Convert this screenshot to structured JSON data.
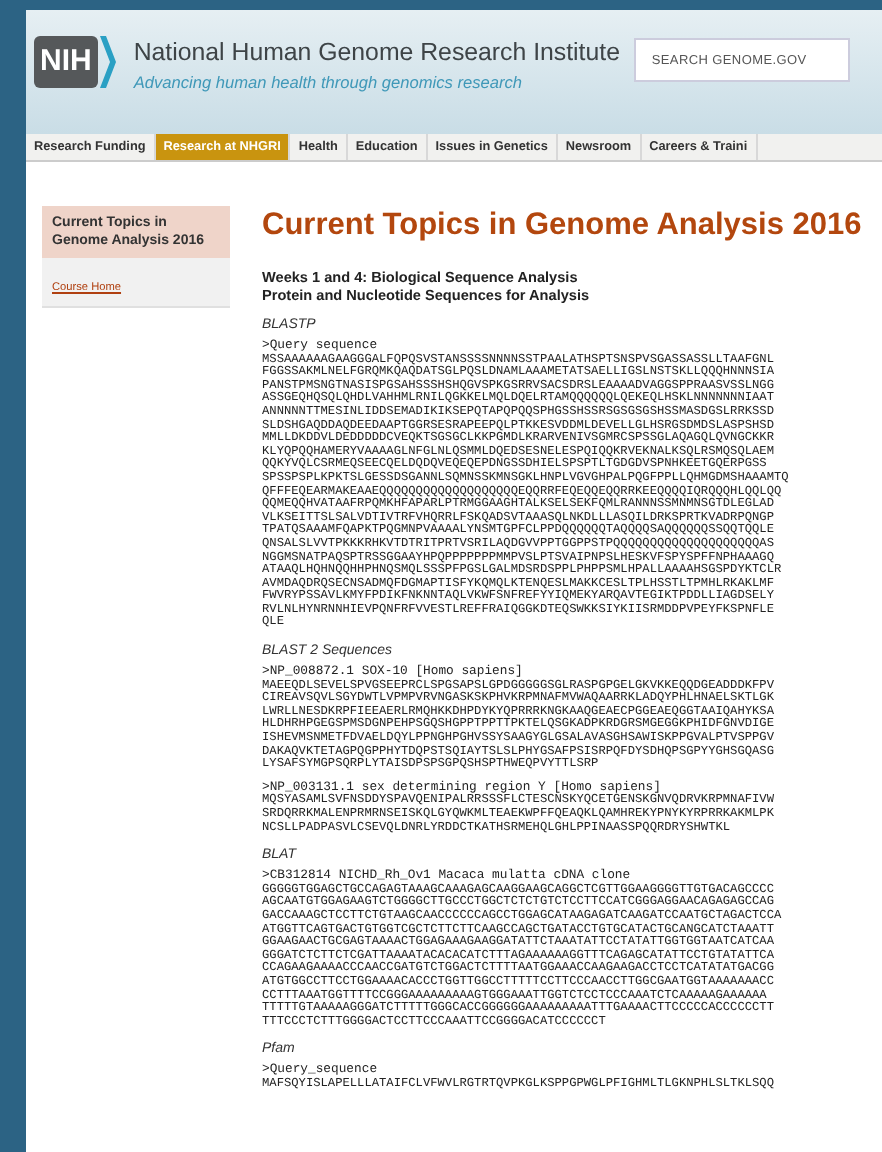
{
  "header": {
    "logo_text": "NIH",
    "org_name": "National Human Genome Research Institute",
    "tagline": "Advancing human health through genomics research",
    "search": {
      "placeholder": "SEARCH GENOME.GOV"
    }
  },
  "nav": [
    {
      "label": "Research Funding",
      "selected": false
    },
    {
      "label": "Research at NHGRI",
      "selected": true
    },
    {
      "label": "Health",
      "selected": false
    },
    {
      "label": "Education",
      "selected": false
    },
    {
      "label": "Issues in Genetics",
      "selected": false
    },
    {
      "label": "Newsroom",
      "selected": false
    },
    {
      "label": "Careers & Traini",
      "selected": false
    }
  ],
  "sidebar": {
    "title": "Current Topics in Genome Analysis 2016",
    "links": [
      "Course Home"
    ]
  },
  "content": {
    "title": "Current Topics in Genome Analysis 2016",
    "subtitle_lines": [
      "Weeks 1 and 4: Biological Sequence Analysis",
      "Protein and Nucleotide Sequences for Analysis"
    ],
    "sections": [
      {
        "heading": "BLASTP",
        "sequences": [
          {
            "header": ">Query sequence",
            "lines": [
              "MSSAAAAAAGAAGGGALFQPQSVSTANSSSSNNNNSSTPAALATHSPTSNSPVSGASSASSLLTAAFGNL",
              "FGGSSAKMLNELFGRQMKQAQDATSGLPQSLDNAMLAAAMETATSAELLIGSLNSTSKLLQQQHNNNSIA",
              "PANSTPMSNGTNASISPGSAHSSSHSHQGVSPKGSRRVSACSDRSLEAAAADVAGGSPPRAASVSSLNGG",
              "ASSGEQHQSQLQHDLVAHHMLRNILQGKKELMQLDQELRTAMQQQQQQLQEKEQLHSKLNNNNNNNIAAT",
              "ANNNNNTTMESINLIDDSEMADIKIKSEPQTAPQPQQSPHGSSHSSRSGSGSGSHSSMASDGSLRRKSSD",
              "SLDSHGAQDDAQDEEDAAPTGGRSESRAPEEPQLPTKKESVDDMLDEVELLGLHSRGSDMDSLASPSHSD",
              "MMLLDKDDVLDEDDDDDCVEQKTSGSGCLKKPGMDLKRARVENIVSGMRCSPSSGLAQAGQLQVNGCKKR",
              "KLYQPQQHAMERYVAAAAGLNFGLNLQSMMLDQEDSESNELESPQIQQKRVEKNALKSQLRSMQSQLAEM",
              "QQKYVQLCSRMEQSEECQELDQDQVEQEQEPDNGSSDHIELSPSPTLTGDGDVSPNHKEETGQERPGSS",
              "SPSSPSPLKPKTSLGESSDSGANNLSQMNSSKMNSGKLHNPLVGVGHPALPQGFPPLLQHMGDMSHAAAMTQ",
              "QFFFEQEARMAKEAAEQQQQQQQQQQQQQQQQQQQEQQRRFEQEQQEQQRRKEEQQQQIQRQQQHLQQLQQ",
              "QQMEQQHVATAAFRPQMKHFAPARLPTRMGGAAGHTALKSELSEKFQMLRANNNSSMNMNSGTDLEGLAD",
              "VLKSEITTSLSALVDTIVTRFVHQRRLFSKQADSVTAAASQLNKDLLLASQILDRKSPRTKVADRPQNGP",
              "TPATQSAAAMFQAPKTPQGMNPVAAAALYNSMTGPFCLPPDQQQQQQTAQQQQSAQQQQQQSSQQTQQLE",
              "QNSALSLVVTPKKKRHKVTDTRITPRTVSRILAQDGVVPPTGGPPSTPQQQQQQQQQQQQQQQQQQQQAS",
              "NGGMSNATPAQSPTRSSGGAAYHPQPPPPPPPMMPVSLPTSVAIPNPSLHESKVFSPYSPFFNPHAAAGQ",
              "ATAAQLHQHNQQHHPHNQSMQLSSSPFPGSLGALMDSRDSPPLPHPPSMLHPALLAAAAHSGSPDYKTCLR",
              "AVMDAQDRQSECNSADMQFDGMAPTISFYKQMQLKTENQESLMAKKCESLTPLHSSTLTPMHLRKAKLMF",
              "FWVRYPSSAVLKMYFPDIKFNKNNTAQLVKWFSNFREFYYIQMEKYARQAVTEGIKTPDDLLIAGDSELY",
              "RVLNLHYNRNNHIEVPQNFRFVVESTLREFFRAIQGGKDTEQSWKKSIYKIISRMDDPVPEYFKSPNFLE",
              "QLE"
            ]
          }
        ]
      },
      {
        "heading": "BLAST 2 Sequences",
        "sequences": [
          {
            "header": ">NP_008872.1 SOX-10 [Homo sapiens]",
            "lines": [
              "MAEEQDLSEVELSPVGSEEPRCLSPGSAPSLGPDGGGGGSGLRASPGPGELGKVKKEQQDGEADDDKFPV",
              "CIREAVSQVLSGYDWTLVPMPVRVNGASKSKPHVKRPMNAFMVWAQAARRKLADQYPHLHNAELSKTLGK",
              "LWRLLNESDKRPFIEEAERLRMQHKKDHPDYKYQPRRRKNGKAAQGEAECPGGEAEQGGTAAIQAHYKSA",
              "HLDHRHPGEGSPMSDGNPEHPSGQSHGPPTPPTTPKTELQSGKADPKRDGRSMGEGGKPHIDFGNVDIGE",
              "ISHEVMSNMETFDVAELDQYLPPNGHPGHVSSYSAAGYGLGSALAVASGHSAWISKPPGVALPTVSPPGV",
              "DAKAQVKTETAGPQGPPHYTDQPSTSQIAYTSLSLPHYGSAFPSISRPQFDYSDHQPSGPYYGHSGQASG",
              "LYSAFSYMGPSQRPLYTAISDPSPSGPQSHSPTHWEQPVYTTLSRP"
            ]
          },
          {
            "header": ">NP_003131.1 sex determining region Y [Homo sapiens]",
            "lines": [
              "MQSYASAMLSVFNSDDYSPAVQENIPALRRSSSFLCTESCNSKYQCETGENSKGNVQDRVKRPMNAFIVW",
              "SRDQRRKMALENPRMRNSEISKQLGYQWKMLTEAEKWPFFQEAQKLQAMHREKYPNYKYRPRRKAKMLPK",
              "NCSLLPADPASVLCSEVQLDNRLYRDDCTKATHSRMEHQLGHLPPINAASSPQQRDRYSHWTKL"
            ]
          }
        ]
      },
      {
        "heading": "BLAT",
        "sequences": [
          {
            "header": ">CB312814 NICHD_Rh_Ov1 Macaca mulatta cDNA clone",
            "lines": [
              "GGGGGTGGAGCTGCCAGAGTAAAGCAAAGAGCAAGGAAGCAGGCTCGTTGGAAGGGGTTGTGACAGCCCC",
              "AGCAATGTGGAGAAGTCTGGGGCTTGCCCTGGCTCTCTGTCTCCTTCCATCGGGAGGAACAGAGAGCCAG",
              "GACCAAAGCTCCTTCTGTAAGCAACCCCCCAGCCTGGAGCATAAGAGATCAAGATCCAATGCTAGACTCCA",
              "ATGGTTCAGTGACTGTGGTCGCTCTTCTTCAAGCCAGCTGATACCTGTGCATACTGCANGCATCTAAATT",
              "GGAAGAACTGCGAGTAAAACTGGAGAAAGAAGGATATTCTAAATATTCCTATATTGGTGGTAATCATCAA",
              "GGGATCTCTTCTCGATTAAAATACACACATCTTTAGAAAAAAGGTTTCAGAGCATATTCCTGTATATTCA",
              "CCAGAAGAAAACCCAACCGATGTCTGGACTCTTTTAATGGAAACCAAGAAGACCTCCTCATATATGACGG",
              "ATGTGGCCTTCCTGGAAAACACCCTGGTTGGCCTTTTTCCTTCCCAACCTTGGCGAATGGTAAAAAAACC",
              "CCTTTAAATGGTTTTCCGGGAAAAAAAAAGTGGGAAATTGGTCTCCTCCCAAATCTCAAAAAGAAAAAA",
              "TTTTTGTAAAAAGGGATCTTTTTGGGCACCGGGGGGAAAAAAAAATTTGAAAACTTCCCCCACCCCCCTT",
              "TTTCCCTCTTTGGGGACTCCTTCCCAAATTCCGGGGACATCCCCCCT"
            ]
          }
        ]
      },
      {
        "heading": "Pfam",
        "sequences": [
          {
            "header": ">Query_sequence",
            "lines": [
              "MAFSQYISLAPELLLATAIFCLVFWVLRGTRTQVPKGLKSPPGPWGLPFIGHMLTLGKNPHLSLTKLSQQ"
            ]
          }
        ]
      }
    ]
  }
}
